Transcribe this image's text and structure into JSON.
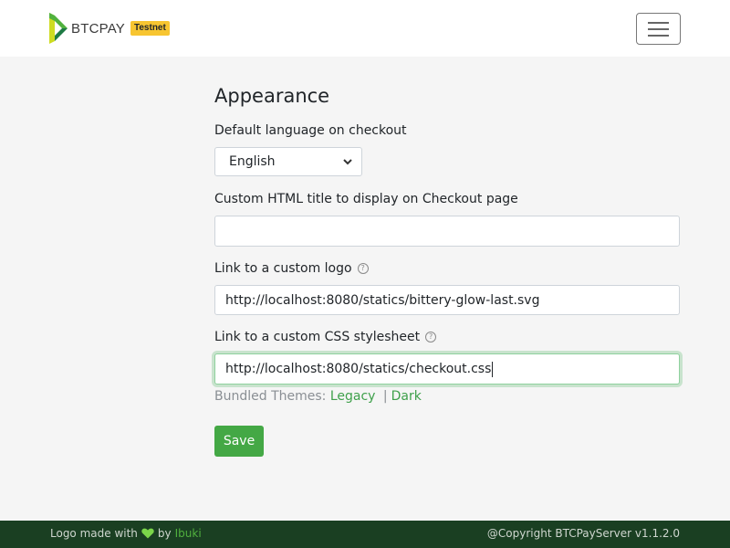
{
  "header": {
    "brand_text": "BTCPAY",
    "badge": "Testnet",
    "logo_icon": "btcpay-logo-icon",
    "menu_icon": "hamburger-menu-icon"
  },
  "form": {
    "heading": "Appearance",
    "language_label": "Default language on checkout",
    "language_selected": "English",
    "html_title_label": "Custom HTML title to display on Checkout page",
    "html_title_value": "",
    "logo_label": "Link to a custom logo",
    "logo_value": "http://localhost:8080/statics/bittery-glow-last.svg",
    "css_label": "Link to a custom CSS stylesheet",
    "css_value": "http://localhost:8080/statics/checkout.css",
    "themes_prefix": "Bundled Themes:",
    "theme_legacy": "Legacy",
    "theme_separator": "|",
    "theme_dark": "Dark",
    "save_label": "Save",
    "help_glyph": "?"
  },
  "footer": {
    "logo_credit_prefix": "Logo made with",
    "logo_credit_by": "by",
    "logo_credit_author": "Ibuki",
    "copyright": "@Copyright BTCPayServer v1.1.2.0"
  },
  "colors": {
    "accent": "#44a845",
    "footer_bg": "#1a3f22",
    "badge": "#f7c531",
    "link": "#3fa04b"
  }
}
